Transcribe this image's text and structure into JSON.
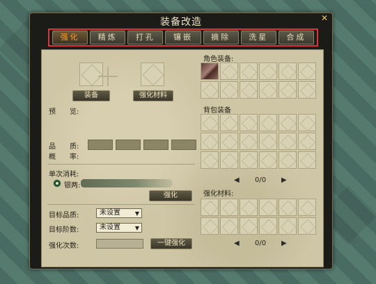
{
  "window": {
    "title": "装备改造"
  },
  "tabs": [
    {
      "label": "强化",
      "active": true
    },
    {
      "label": "精炼",
      "active": false
    },
    {
      "label": "打孔",
      "active": false
    },
    {
      "label": "镶嵌",
      "active": false
    },
    {
      "label": "摘除",
      "active": false
    },
    {
      "label": "洗星",
      "active": false
    },
    {
      "label": "合成",
      "active": false
    }
  ],
  "left": {
    "equip_label": "装备",
    "material_label": "强化材料",
    "preview_label": "预　　览:",
    "quality_label": "品　　质:",
    "rate_label": "概　　率:",
    "single_cost_label": "单次消耗:",
    "silver_label": "银两:",
    "strengthen_button": "强化",
    "target_quality_label": "目标品质:",
    "target_quality_value": "未设置",
    "target_level_label": "目标阶数:",
    "target_level_value": "未设置",
    "strengthen_count_label": "强化次数:",
    "one_key_button": "一键强化"
  },
  "right": {
    "role_equip_label": "角色装备:",
    "bag_equip_label": "背包装备",
    "bag_pager": "0/0",
    "material_label": "强化材料:",
    "material_pager": "0/0"
  },
  "colors": {
    "active_tab": "#ff9a2a",
    "highlight_border": "#e0323a"
  },
  "icons": {
    "close": "close-icon",
    "prev": "arrow-left-icon",
    "next": "arrow-right-icon"
  }
}
